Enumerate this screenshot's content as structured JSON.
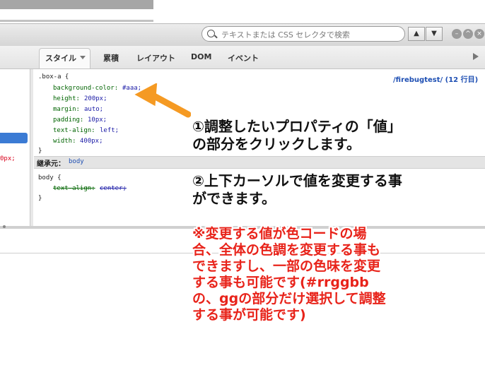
{
  "toolbar": {
    "search_placeholder": "テキストまたは CSS セレクタで検索",
    "up_label": "▲",
    "down_label": "▼"
  },
  "tabs": [
    {
      "label": "スタイル"
    },
    {
      "label": "累積"
    },
    {
      "label": "レイアウト"
    },
    {
      "label": "DOM"
    },
    {
      "label": "イベント"
    }
  ],
  "left_pane": {
    "value_fragment": "0px;"
  },
  "rule1": {
    "selector": ".box-a {",
    "source": "/firebugtest/ (12 行目)",
    "close": "}",
    "props": [
      {
        "name": "background-color:",
        "value": "#aaa;"
      },
      {
        "name": "height:",
        "value": "200px;"
      },
      {
        "name": "margin:",
        "value": "auto;"
      },
      {
        "name": "padding:",
        "value": "10px;"
      },
      {
        "name": "text-align:",
        "value": "left;"
      },
      {
        "name": "width:",
        "value": "400px;"
      }
    ]
  },
  "inherit": {
    "label": "継承元：",
    "element": "body"
  },
  "rule2": {
    "selector": "body {",
    "prop_name": "text-align:",
    "prop_value": "center;",
    "close": "}"
  },
  "annotation": {
    "step1_line1": "①調整したいプロパティの「値」",
    "step1_line2": "の部分をクリックします。",
    "step2_line1": "②上下カーソルで値を変更する事",
    "step2_line2": "ができます。",
    "note_lines": [
      "※変更する値が色コードの場",
      "合、全体の色調を変更する事も",
      "できますし、一部の色味を変更",
      "する事も可能です(#rrggbb",
      "の、ggの部分だけ選択して調整",
      "する事が可能です)"
    ]
  },
  "colors": {
    "arrow": "#f59a23",
    "note_red": "#e8231a",
    "selection": "#3b7bd4"
  }
}
